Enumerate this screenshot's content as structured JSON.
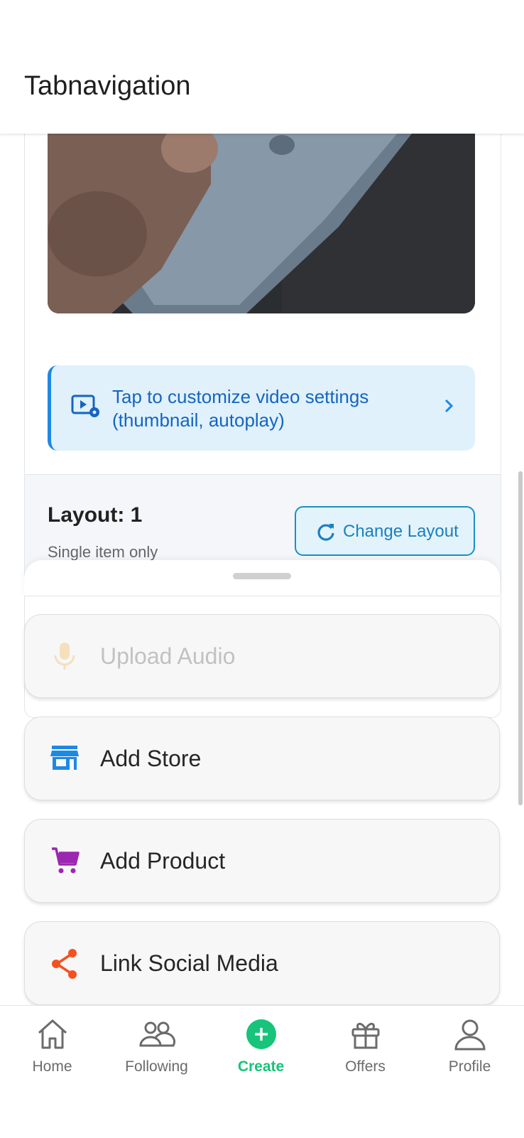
{
  "header": {
    "title": "Tabnavigation"
  },
  "video_banner": {
    "text": "Tap to customize video settings (thumbnail, autoplay)"
  },
  "layout": {
    "title": "Layout: 1",
    "subtitle": "Single item only",
    "change_button": "Change Layout"
  },
  "actions": [
    {
      "label": "Upload Audio",
      "icon": "audio-icon",
      "color": "#f39c12"
    },
    {
      "label": "Add Store",
      "icon": "store-icon",
      "color": "#1e88e5"
    },
    {
      "label": "Add Product",
      "icon": "cart-icon",
      "color": "#9c27b0"
    },
    {
      "label": "Link Social Media",
      "icon": "share-icon",
      "color": "#f4511e"
    }
  ],
  "bottom_nav": {
    "tabs": [
      {
        "label": "Home",
        "icon": "home-icon"
      },
      {
        "label": "Following",
        "icon": "following-icon"
      },
      {
        "label": "Create",
        "icon": "create-icon",
        "active": true
      },
      {
        "label": "Offers",
        "icon": "gift-icon"
      },
      {
        "label": "Profile",
        "icon": "profile-icon"
      }
    ]
  },
  "colors": {
    "accent_green": "#16c47a",
    "link_blue": "#1565c0",
    "primary_blue": "#1e88e5"
  }
}
